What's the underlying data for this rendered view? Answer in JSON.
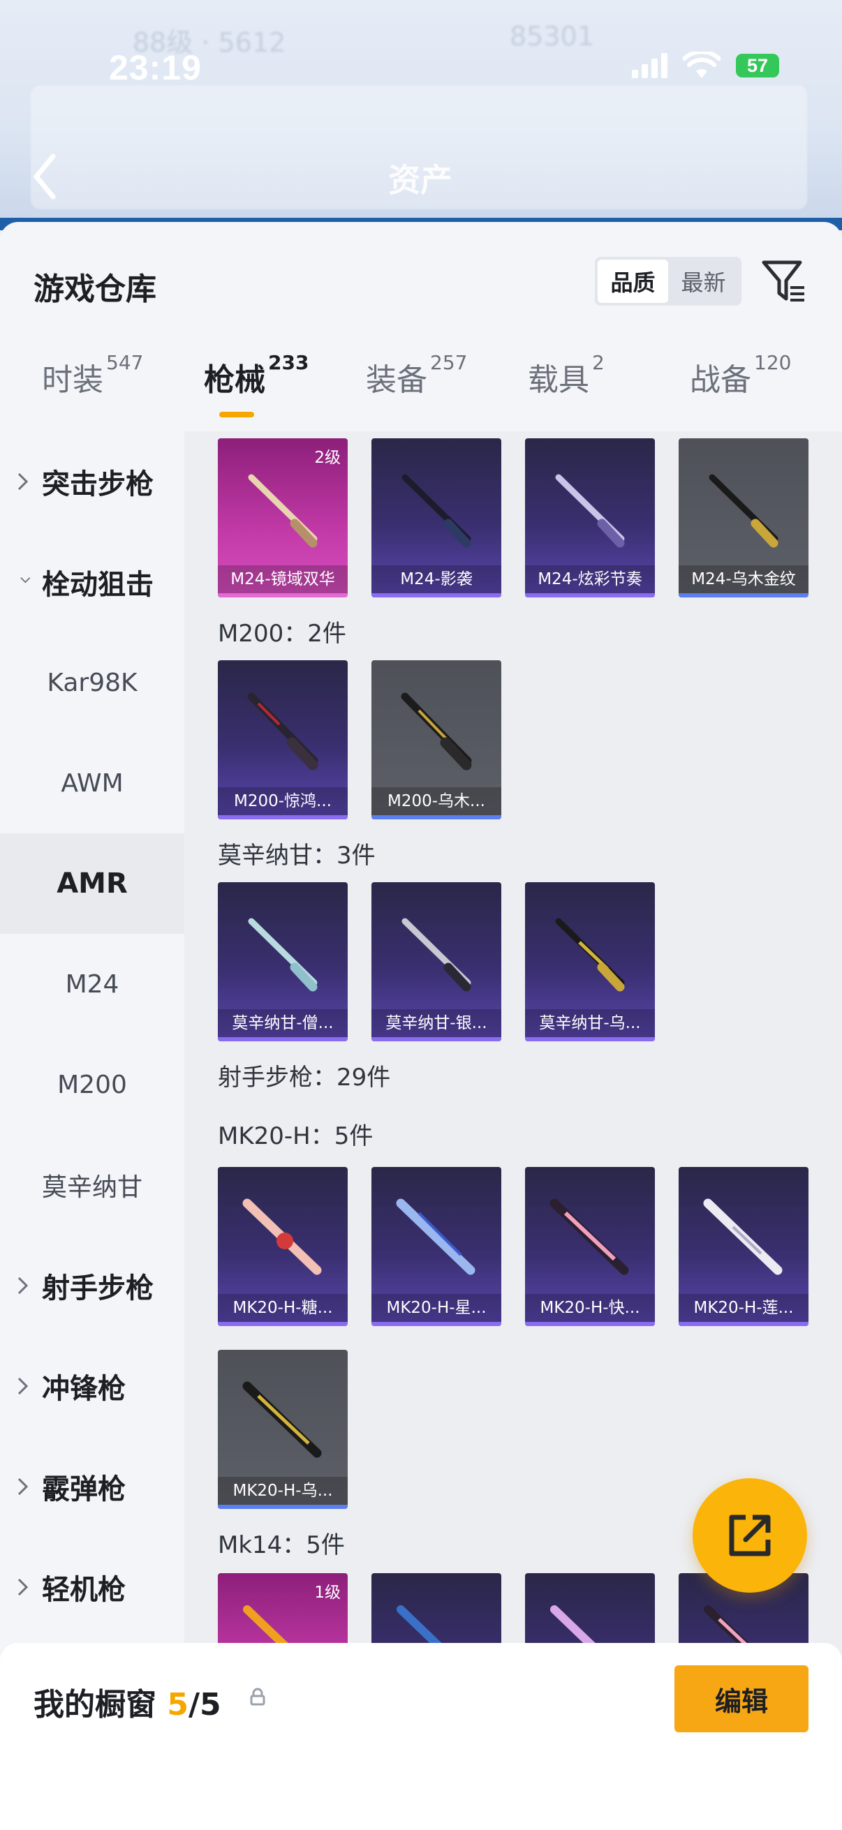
{
  "status_bar": {
    "time": "23:19",
    "battery": "57"
  },
  "header": {
    "title": "资产"
  },
  "sheet": {
    "title": "游戏仓库",
    "sort": [
      "品质",
      "最新"
    ],
    "tabs": [
      {
        "label": "时装",
        "count": "547"
      },
      {
        "label": "枪械",
        "count": "233"
      },
      {
        "label": "装备",
        "count": "257"
      },
      {
        "label": "载具",
        "count": "2"
      },
      {
        "label": "战备",
        "count": "120"
      }
    ]
  },
  "sidebar": [
    {
      "label": "突击步枪"
    },
    {
      "label": "栓动狙击"
    },
    {
      "label": "Kar98K"
    },
    {
      "label": "AWM"
    },
    {
      "label": "AMR"
    },
    {
      "label": "M24"
    },
    {
      "label": "M200"
    },
    {
      "label": "莫辛纳甘"
    },
    {
      "label": "射手步枪"
    },
    {
      "label": "冲锋枪"
    },
    {
      "label": "霰弹枪"
    },
    {
      "label": "轻机枪"
    }
  ],
  "groups": {
    "m24_row": [
      {
        "name": "M24-镜域双华",
        "level": "2级"
      },
      {
        "name": "M24-影袭"
      },
      {
        "name": "M24-炫彩节奏"
      },
      {
        "name": "M24-乌木金纹"
      }
    ],
    "m200_title": "M200：2件",
    "m200": [
      {
        "name": "M200-惊鸿..."
      },
      {
        "name": "M200-乌木..."
      }
    ],
    "mosin_title": "莫辛纳甘：3件",
    "mosin": [
      {
        "name": "莫辛纳甘-僧..."
      },
      {
        "name": "莫辛纳甘-银..."
      },
      {
        "name": "莫辛纳甘-乌..."
      }
    ],
    "dmr_title": "射手步枪：29件",
    "mk20_title": "MK20-H：5件",
    "mk20": [
      {
        "name": "MK20-H-糖..."
      },
      {
        "name": "MK20-H-星..."
      },
      {
        "name": "MK20-H-快..."
      },
      {
        "name": "MK20-H-莲..."
      },
      {
        "name": "MK20-H-乌..."
      }
    ],
    "mk14_title": "Mk14：5件",
    "mk14": [
      {
        "level": "1级"
      }
    ]
  },
  "bottom_bar": {
    "label": "我的橱窗",
    "current": "5",
    "total": "/5",
    "edit": "编辑"
  }
}
